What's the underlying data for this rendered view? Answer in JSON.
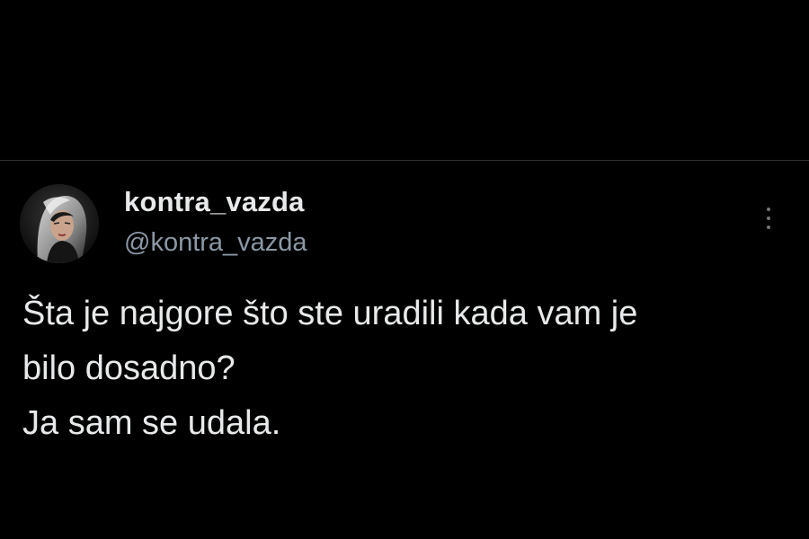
{
  "tweet": {
    "display_name": "kontra_vazda",
    "handle": "@kontra_vazda",
    "text_lines": [
      "Šta je najgore što ste uradili kada vam je",
      "bilo dosadno?",
      "Ja sam se udala."
    ],
    "more_icon": "more-vertical-icon",
    "avatar_icon": "profile-photo"
  },
  "colors": {
    "background": "#000000",
    "primary_text": "#e7e9ea",
    "secondary_text": "#8b98a5",
    "divider": "#2f3336"
  }
}
